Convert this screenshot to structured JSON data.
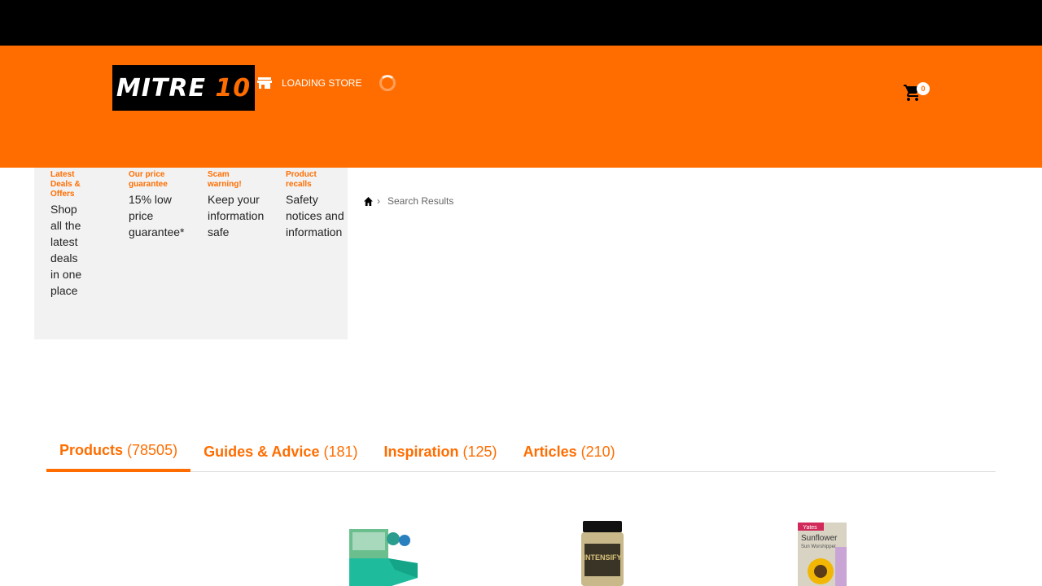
{
  "header": {
    "logo_text_a": "MITRE ",
    "logo_text_b": "10",
    "store_label": "LOADING STORE",
    "cart_count": "0"
  },
  "promo": [
    {
      "head": "Latest Deals & Offers",
      "body": "Shop all the latest deals in one place"
    },
    {
      "head": "Our price guarantee",
      "body": "15% low price guarantee*"
    },
    {
      "head": "Scam warning!",
      "body": "Keep your information safe"
    },
    {
      "head": "Product recalls",
      "body": "Safety notices and information"
    }
  ],
  "breadcrumb": {
    "separator": "›",
    "current": "Search Results"
  },
  "tabs": [
    {
      "label": "Products",
      "count": "(78505)"
    },
    {
      "label": "Guides & Advice",
      "count": "(181)"
    },
    {
      "label": "Inspiration",
      "count": "(125)"
    },
    {
      "label": "Articles",
      "count": "(210)"
    }
  ],
  "products": {
    "item2_label": "INTENSIFY",
    "item3_brand": "Yates",
    "item3_title": "Sunflower",
    "item3_subtitle": "Sun Worshipper"
  },
  "colors": {
    "brand": "#ff6d00",
    "topbar": "#000000",
    "promo_bg": "#f2f2f2"
  }
}
